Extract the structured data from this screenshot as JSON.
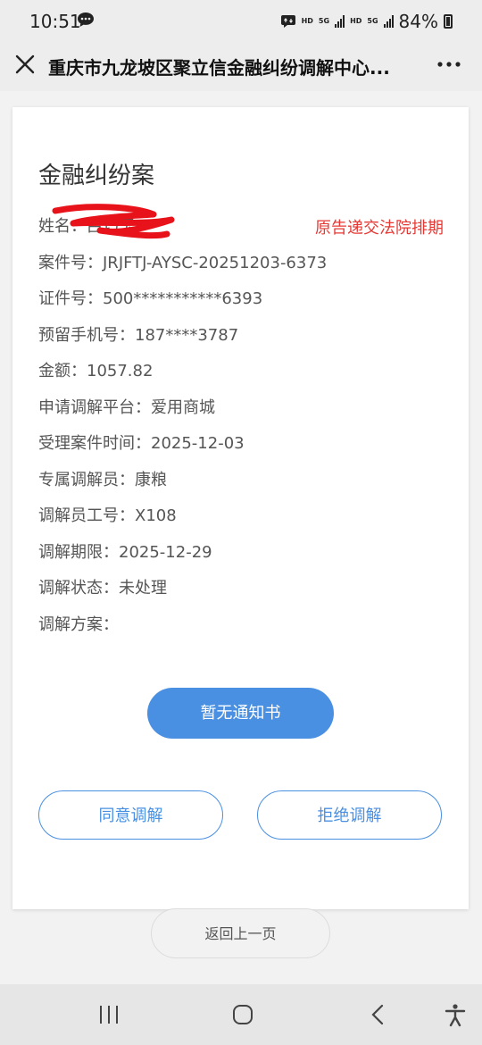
{
  "status_bar": {
    "time": "10:51",
    "network_hd": "HD",
    "network_5g": "5G",
    "battery": "84%"
  },
  "title_bar": {
    "title": "重庆市九龙坡区聚立信金融纠纷调解中心..."
  },
  "card": {
    "heading": "金融纠纷案",
    "status_note": "原告递交法院排期",
    "fields": [
      {
        "label": "姓名：",
        "value": "吕巧玉"
      },
      {
        "label": "案件号：",
        "value": "JRJFTJ-AYSC-20251203-6373"
      },
      {
        "label": "证件号：",
        "value": "500***********6393"
      },
      {
        "label": "预留手机号：",
        "value": "187****3787"
      },
      {
        "label": "金额：",
        "value": "1057.82"
      },
      {
        "label": "申请调解平台：",
        "value": "爱用商城"
      },
      {
        "label": "受理案件时间：",
        "value": "2025-12-03"
      },
      {
        "label": "专属调解员：",
        "value": "康粮"
      },
      {
        "label": "调解员工号：",
        "value": "X108"
      },
      {
        "label": "调解期限：",
        "value": "2025-12-29"
      },
      {
        "label": "调解状态：",
        "value": "未处理"
      },
      {
        "label": "调解方案：",
        "value": ""
      }
    ],
    "notice_button": "暂无通知书",
    "agree_button": "同意调解",
    "reject_button": "拒绝调解"
  },
  "back_button": "返回上一页",
  "colors": {
    "primary": "#4a90e2",
    "alert": "#e53935"
  },
  "icons": {
    "close": "close-icon",
    "more": "more-icon",
    "recent_apps": "recent-apps-icon",
    "home": "home-icon",
    "back": "back-icon",
    "accessibility": "accessibility-icon"
  }
}
